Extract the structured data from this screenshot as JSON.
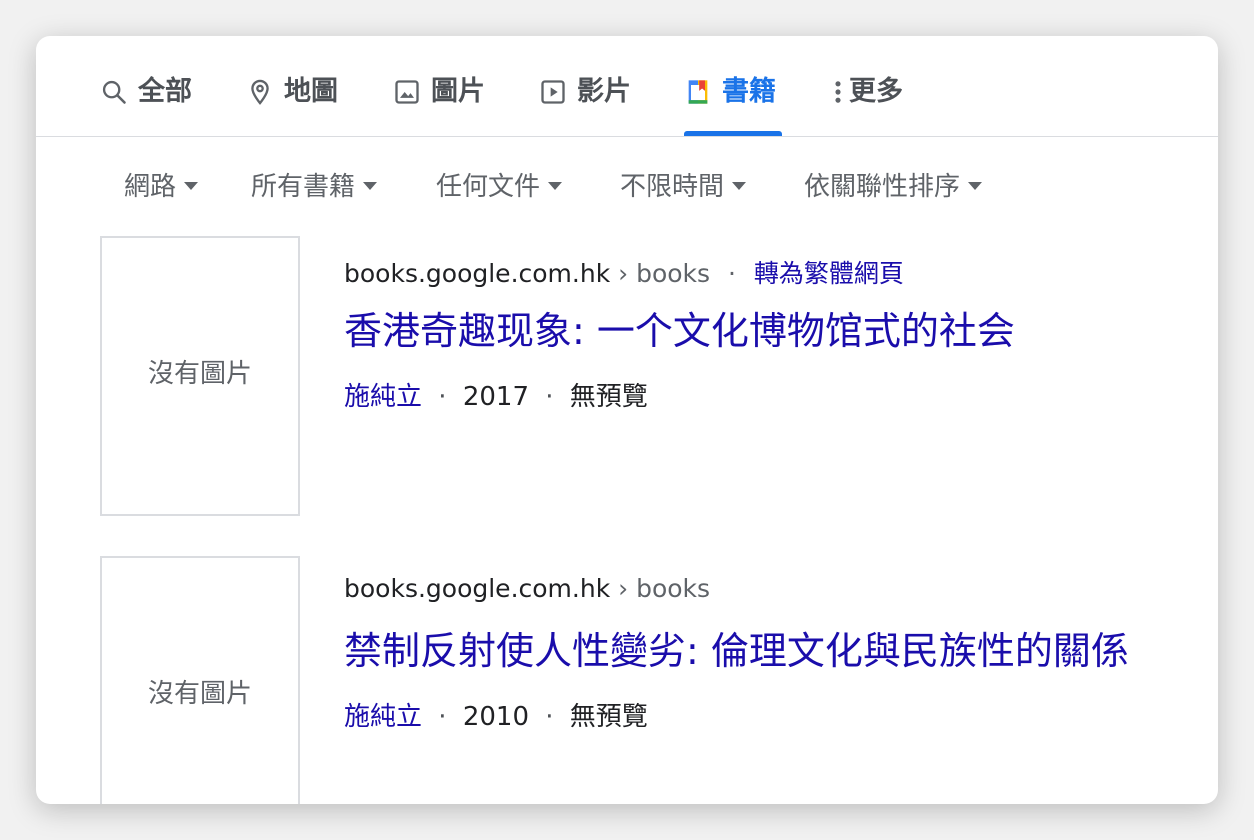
{
  "tabs": [
    {
      "label": "全部",
      "icon": "search-icon"
    },
    {
      "label": "地圖",
      "icon": "map-pin-icon"
    },
    {
      "label": "圖片",
      "icon": "image-icon"
    },
    {
      "label": "影片",
      "icon": "play-icon"
    },
    {
      "label": "書籍",
      "icon": "book-icon",
      "active": true
    },
    {
      "label": "更多",
      "icon": "more-vert-icon"
    }
  ],
  "filters": [
    {
      "label": "網路"
    },
    {
      "label": "所有書籍"
    },
    {
      "label": "任何文件"
    },
    {
      "label": "不限時間"
    },
    {
      "label": "依關聯性排序"
    }
  ],
  "results": [
    {
      "thumbnail_text": "沒有圖片",
      "domain": "books.google.com.hk",
      "path_sep": "›",
      "path": "books",
      "dot": "·",
      "translate_link": "轉為繁體網頁",
      "title": "香港奇趣现象: 一个文化博物馆式的社会",
      "author": "施純立",
      "year": "2017",
      "preview": "無預覽",
      "meta_sep": "·"
    },
    {
      "thumbnail_text": "沒有圖片",
      "domain": "books.google.com.hk",
      "path_sep": "›",
      "path": "books",
      "title": "禁制反射使人性變劣: 倫理文化與民族性的關係",
      "author": "施純立",
      "year": "2010",
      "preview": "無預覽",
      "meta_sep": "·"
    }
  ],
  "colors": {
    "accent": "#1a73e8",
    "link": "#1a0dab",
    "text": "#202124",
    "muted": "#5f6368"
  }
}
